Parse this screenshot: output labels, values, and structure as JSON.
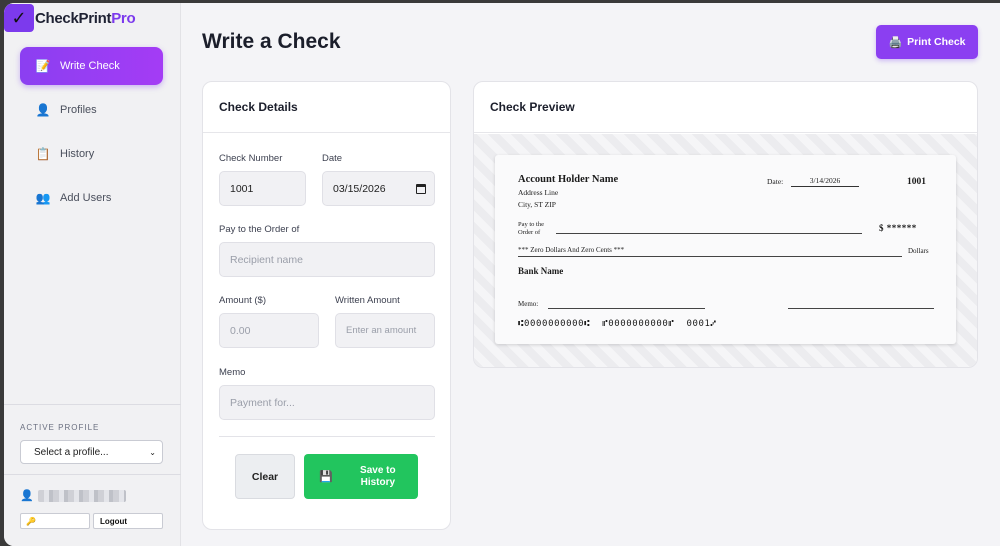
{
  "app": {
    "logo_check": "✓",
    "logo_main": "CheckPrint",
    "logo_accent": "Pro"
  },
  "sidebar": {
    "items": [
      {
        "label": "Write Check",
        "icon": "📝",
        "active": true
      },
      {
        "label": "Profiles",
        "icon": "👤",
        "active": false
      },
      {
        "label": "History",
        "icon": "📋",
        "active": false
      },
      {
        "label": "Add Users",
        "icon": "👥",
        "active": false
      }
    ],
    "active_profile_label": "ACTIVE PROFILE",
    "profile_select_value": "Select a profile...",
    "user_icon": "👤",
    "key_icon": "🔑",
    "logout_label": "Logout"
  },
  "header": {
    "title": "Write a Check",
    "print_icon": "🖨️",
    "print_label": "Print Check"
  },
  "details": {
    "title": "Check Details",
    "check_number_label": "Check Number",
    "check_number_value": "1001",
    "date_label": "Date",
    "date_value": "03/15/2026",
    "payee_label": "Pay to the Order of",
    "payee_placeholder": "Recipient name",
    "amount_label": "Amount ($)",
    "amount_placeholder": "0.00",
    "written_label": "Written Amount",
    "written_placeholder": "Enter an amount",
    "memo_label": "Memo",
    "memo_placeholder": "Payment for...",
    "clear_label": "Clear",
    "save_icon": "💾",
    "save_label": "Save to History"
  },
  "preview": {
    "title": "Check Preview",
    "account_holder": "Account Holder Name",
    "address_line": "Address Line",
    "city_line": "City, ST ZIP",
    "date_label": "Date:",
    "date_value": "3/14/2026",
    "check_number": "1001",
    "pay_to_label": "Pay to the Order of",
    "amount_text": "$ ******",
    "written_amount": "*** Zero Dollars And Zero Cents ***",
    "dollars_label": "Dollars",
    "bank_name": "Bank Name",
    "memo_label": "Memo:",
    "micr_line": "⑆0000000000⑆  ⑈0000000000⑈  0001⑇"
  },
  "colors": {
    "accent": "#8b3ff1",
    "success": "#22c55e",
    "background": "#f4f4f7"
  }
}
